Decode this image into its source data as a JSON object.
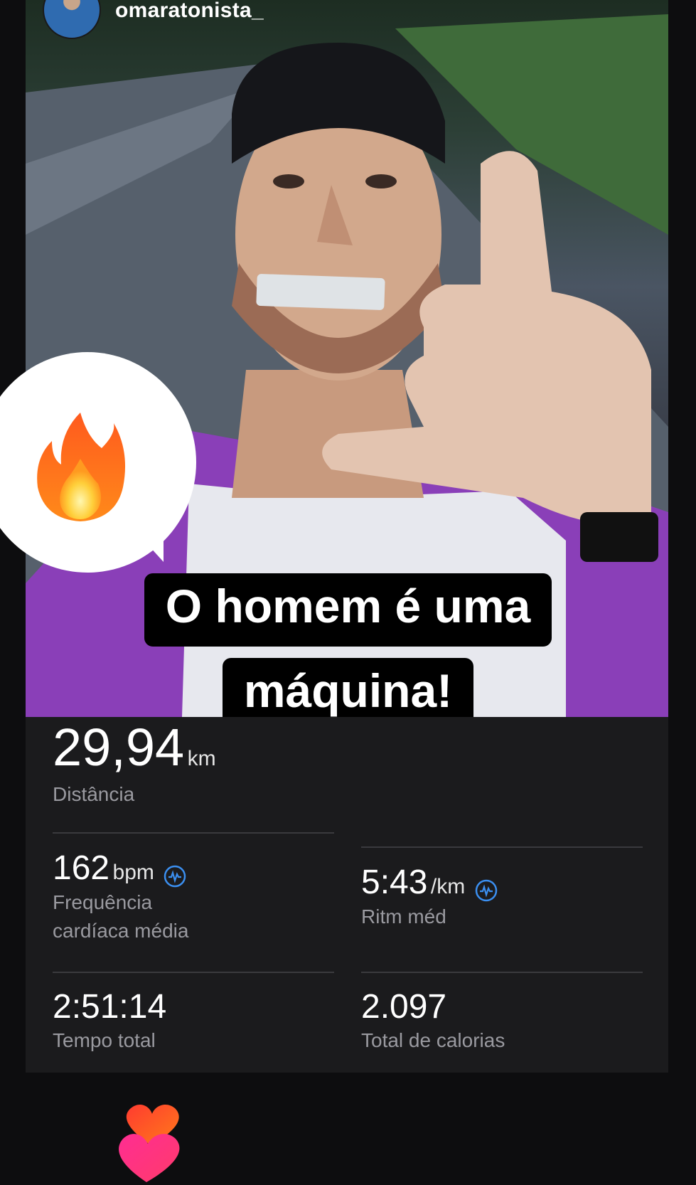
{
  "header": {
    "username": "omaratonista_"
  },
  "caption": {
    "line1": "O homem é uma",
    "line2": "máquina!"
  },
  "reaction": {
    "emoji": "fire-emoji"
  },
  "stats": {
    "distance": {
      "value": "29,94",
      "unit": "km",
      "label": "Distância"
    },
    "heart_rate": {
      "value": "162",
      "unit": "bpm",
      "label_line1": "Frequência",
      "label_line2": "cardíaca média"
    },
    "pace": {
      "value": "5:43",
      "unit": "/km",
      "label": "Ritm méd"
    },
    "total_time": {
      "value": "2:51:14",
      "label": "Tempo total"
    },
    "calories": {
      "value": "2.097",
      "label": "Total de calorias"
    }
  },
  "colors": {
    "accent_icon": "#3b8ff0",
    "background": "#1b1b1d",
    "label_gray": "#9a9aa0"
  }
}
